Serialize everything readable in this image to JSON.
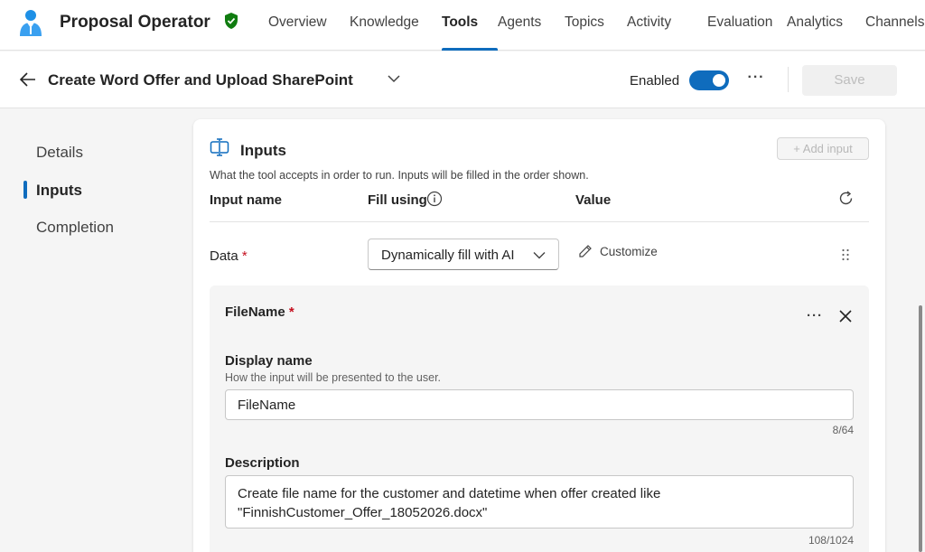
{
  "app": {
    "title": "Proposal Operator",
    "accent_color": "#0f6cbd",
    "logo_icon": "agent-avatar-icon",
    "verified_icon": "shield-check-icon"
  },
  "nav": {
    "tabs": [
      {
        "label": "Overview",
        "active": false
      },
      {
        "label": "Knowledge",
        "active": false
      },
      {
        "label": "Tools",
        "active": true
      },
      {
        "label": "Agents",
        "active": false
      },
      {
        "label": "Topics",
        "active": false
      },
      {
        "label": "Activity",
        "active": false
      },
      {
        "label": "Evaluation",
        "active": false
      },
      {
        "label": "Analytics",
        "active": false
      },
      {
        "label": "Channels",
        "active": false
      }
    ]
  },
  "toolbar": {
    "title": "Create Word Offer and Upload SharePoint",
    "enabled_label": "Enabled",
    "enabled": true,
    "more_label": "···",
    "save_label": "Save"
  },
  "rail": {
    "items": [
      {
        "label": "Details",
        "active": false
      },
      {
        "label": "Inputs",
        "active": true
      },
      {
        "label": "Completion",
        "active": false
      }
    ]
  },
  "inputs": {
    "title": "Inputs",
    "add_input_label": "Add input",
    "description": "What the tool accepts in order to run. Inputs will be filled in the order shown.",
    "columns": {
      "name": "Input name",
      "fill": "Fill using",
      "value": "Value"
    },
    "row": {
      "name": "Data",
      "required_mark": "*",
      "fill_using": "Dynamically fill with AI",
      "customize_label": "Customize"
    }
  },
  "filename_panel": {
    "title": "FileName",
    "required_mark": "*",
    "more_label": "···",
    "display_name": {
      "label": "Display name",
      "hint": "How the input will be presented to the user.",
      "value": "FileName",
      "counter": "8/64"
    },
    "description": {
      "label": "Description",
      "value": "Create file name for the customer and datetime when offer created like\n\"FinnishCustomer_Offer_18052026.docx\"",
      "counter": "108/1024"
    }
  }
}
